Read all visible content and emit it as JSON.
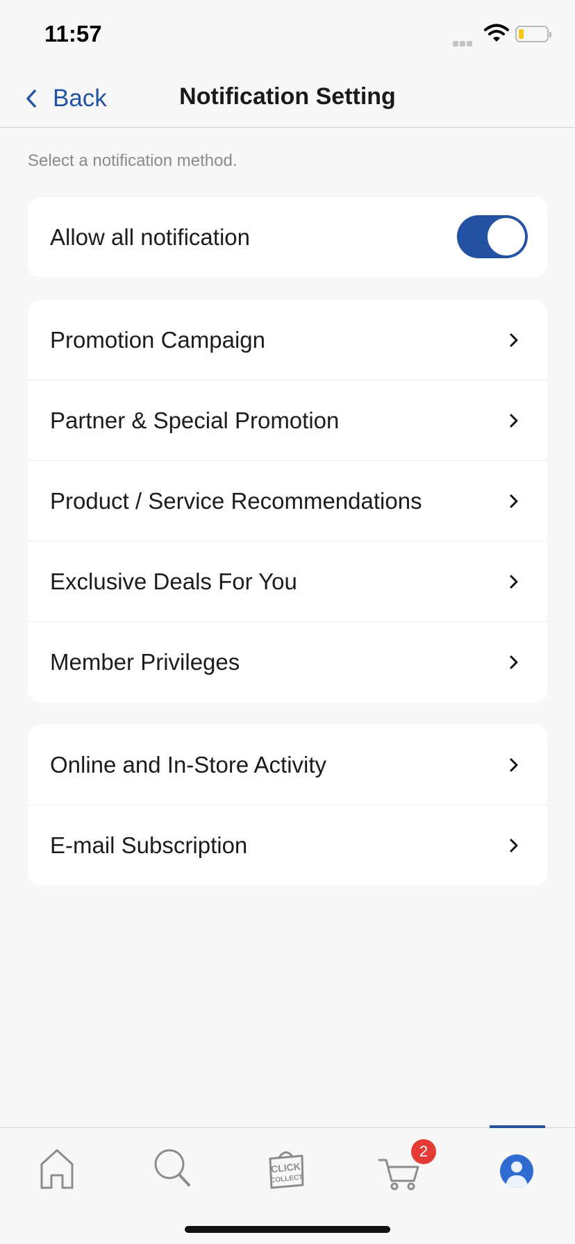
{
  "status_bar": {
    "time": "11:57"
  },
  "nav": {
    "back_label": "Back",
    "title": "Notification Setting"
  },
  "hint": "Select a notification method.",
  "allow_all": {
    "label": "Allow all notification",
    "enabled": true
  },
  "group_a": [
    {
      "label": "Promotion Campaign"
    },
    {
      "label": "Partner & Special Promotion"
    },
    {
      "label": "Product / Service Recommendations"
    },
    {
      "label": "Exclusive Deals For You"
    },
    {
      "label": "Member Privileges"
    }
  ],
  "group_b": [
    {
      "label": "Online and In-Store Activity"
    },
    {
      "label": "E-mail Subscription"
    }
  ],
  "tab_bar": {
    "cart_badge": "2",
    "click_collect_line1": "CLICK",
    "click_collect_line2": "COLLECT",
    "active_tab": "profile"
  },
  "colors": {
    "accent": "#2452a2",
    "badge": "#e53935",
    "background": "#f7f7f7"
  }
}
